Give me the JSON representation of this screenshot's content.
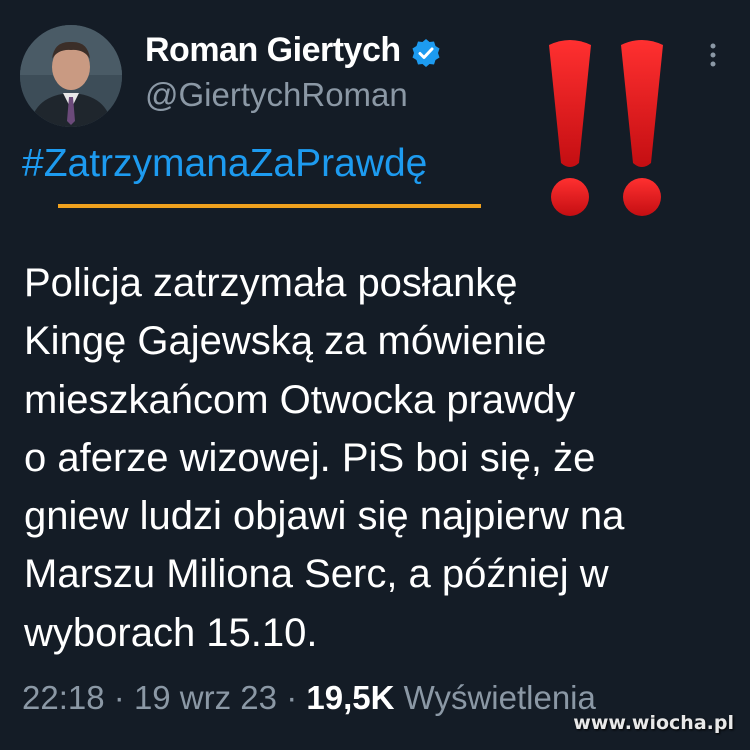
{
  "tweet": {
    "author_name": "Roman Giertych",
    "author_handle": "@GiertychRoman",
    "hashtag": "#ZatrzymanaZaPrawdę",
    "body": "Policja zatrzymała posłankę\nKingę Gajewską za mówienie\nmieszkańcom Otwocka prawdy\no aferze wizowej. PiS boi się, że\ngniew ludzi objawi się najpierw na\nMarszu Miliona Serc, a później w\nwyborach 15.10.",
    "time": "22:18",
    "date": "19 wrz 23",
    "views_count": "19,5K",
    "views_label": "Wyświetlenia",
    "separator": "·"
  },
  "icons": {
    "verified": "verified-badge-icon",
    "more": "more-options-icon",
    "alert": "double-exclamation-icon"
  },
  "colors": {
    "background": "#141c26",
    "link": "#1d9bf0",
    "muted": "#8b98a5",
    "underline": "#f0a11e",
    "exclamation": "#e4161b"
  },
  "watermark": "www.wiocha.pl"
}
